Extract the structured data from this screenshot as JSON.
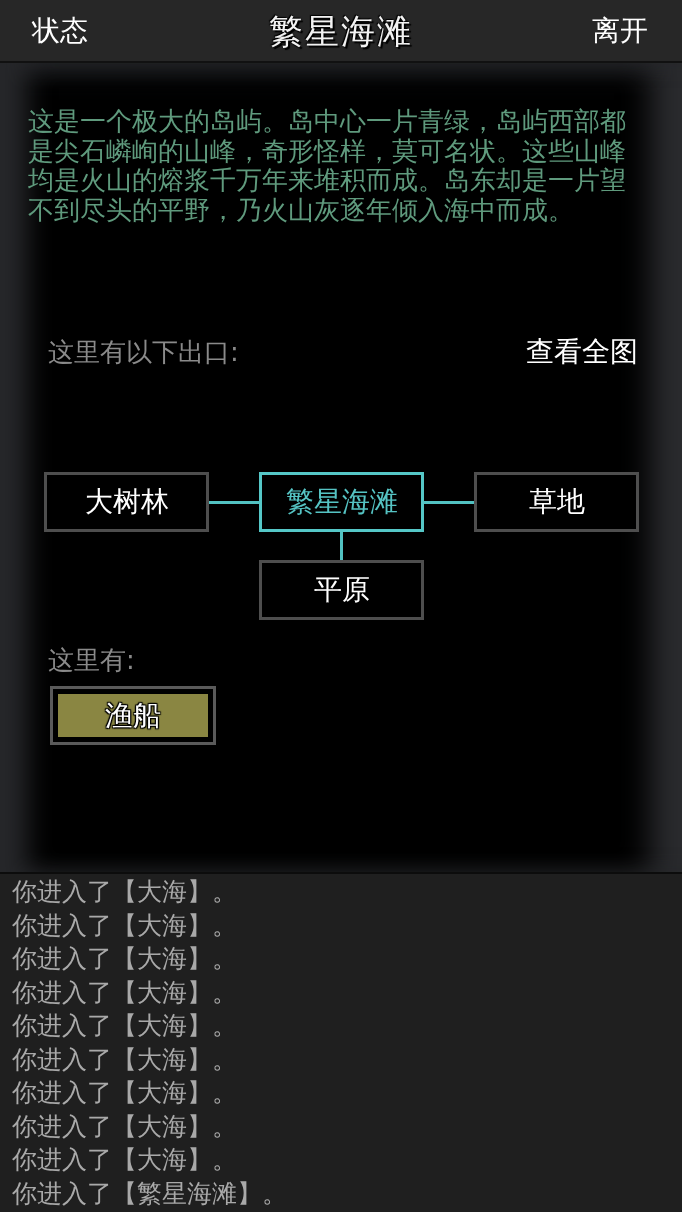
{
  "header": {
    "left_button": "状态",
    "title": "繁星海滩",
    "right_button": "离开"
  },
  "description": "这是一个极大的岛屿。岛中心一片青绿，岛屿西部都是尖石嶙峋的山峰，奇形怪样，莫可名状。这些山峰均是火山的熔浆千万年来堆积而成。岛东却是一片望不到尽头的平野，乃火山灰逐年倾入海中而成。",
  "exits": {
    "heading": "这里有以下出口:",
    "map_link": "查看全图",
    "nodes": [
      {
        "label": "大树林",
        "kind": "west",
        "selected": false
      },
      {
        "label": "繁星海滩",
        "kind": "center",
        "selected": true
      },
      {
        "label": "草地",
        "kind": "east",
        "selected": false
      },
      {
        "label": "平原",
        "kind": "south",
        "selected": false
      }
    ]
  },
  "objects": {
    "heading": "这里有:",
    "items": [
      {
        "label": "渔船"
      }
    ]
  },
  "log": [
    "你进入了【大海】。",
    "你进入了【大海】。",
    "你进入了【大海】。",
    "你进入了【大海】。",
    "你进入了【大海】。",
    "你进入了【大海】。",
    "你进入了【大海】。",
    "你进入了【大海】。",
    "你进入了【大海】。",
    "你进入了【繁星海滩】。"
  ]
}
